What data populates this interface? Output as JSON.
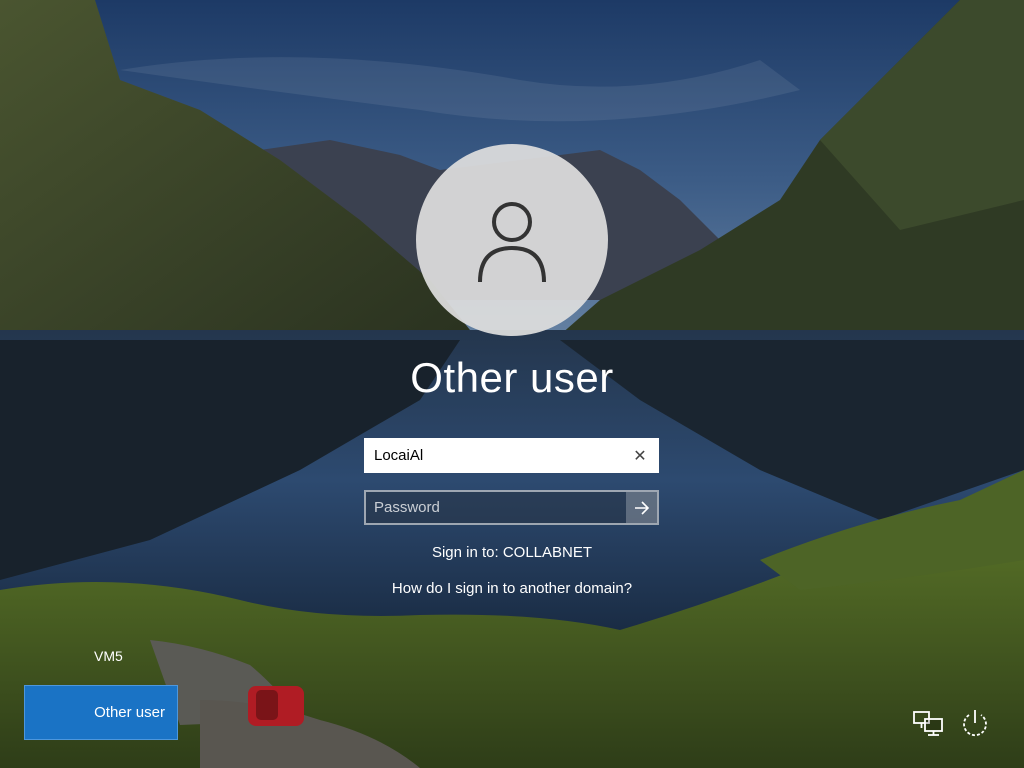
{
  "login": {
    "username": "Other user",
    "username_value": "LocaiAl",
    "password_placeholder": "Password",
    "sign_in_to": "Sign in to: COLLABNET",
    "help_link": "How do I sign in to another domain?"
  },
  "bottom_left": {
    "machine_name": "VM5",
    "tile_label": "Other user"
  },
  "icons": {
    "avatar": "user-silhouette-icon",
    "clear": "close-icon",
    "submit": "arrow-right-icon",
    "network": "network-icon",
    "power": "power-icon"
  },
  "colors": {
    "tile_accent": "#1a73c5",
    "avatar_bg": "#dedede"
  }
}
